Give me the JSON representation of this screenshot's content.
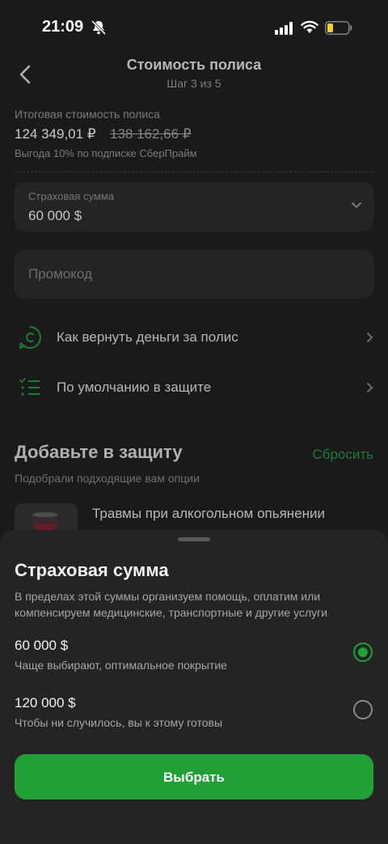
{
  "status_bar": {
    "time": "21:09"
  },
  "header": {
    "title": "Стоимость полиса",
    "step": "Шаг 3 из 5"
  },
  "summary": {
    "label": "Итоговая стоимость полиса",
    "price": "124 349,01 ₽",
    "old_price": "138 162,66 ₽",
    "benefit": "Выгода 10% по подписке СберПрайм"
  },
  "insurance_field": {
    "label": "Страховая сумма",
    "value": "60 000 $"
  },
  "promo_field": {
    "placeholder": "Промокод"
  },
  "links": [
    {
      "label": "Как вернуть деньги за полис",
      "icon": "coin-return-icon"
    },
    {
      "label": "По умолчанию в защите",
      "icon": "checklist-icon"
    }
  ],
  "add_section": {
    "title": "Добавьте в защиту",
    "reset": "Сбросить",
    "subtitle": "Подобрали подходящие вам опции",
    "option_title": "Травмы при алкогольном опьянении"
  },
  "sheet": {
    "title": "Страховая сумма",
    "description": "В пределах этой суммы организуем помощь, оплатим или компенсируем медицинские, транспортные и другие услуги",
    "options": [
      {
        "amount": "60 000 $",
        "note": "Чаще выбирают, оптимальное покрытие",
        "selected": true
      },
      {
        "amount": "120 000 $",
        "note": "Чтобы ни случилось, вы к этому готовы",
        "selected": false
      }
    ],
    "button": "Выбрать"
  },
  "colors": {
    "accent": "#21a038",
    "sheet_bg": "#242424",
    "page_bg": "#1a1a1a"
  }
}
